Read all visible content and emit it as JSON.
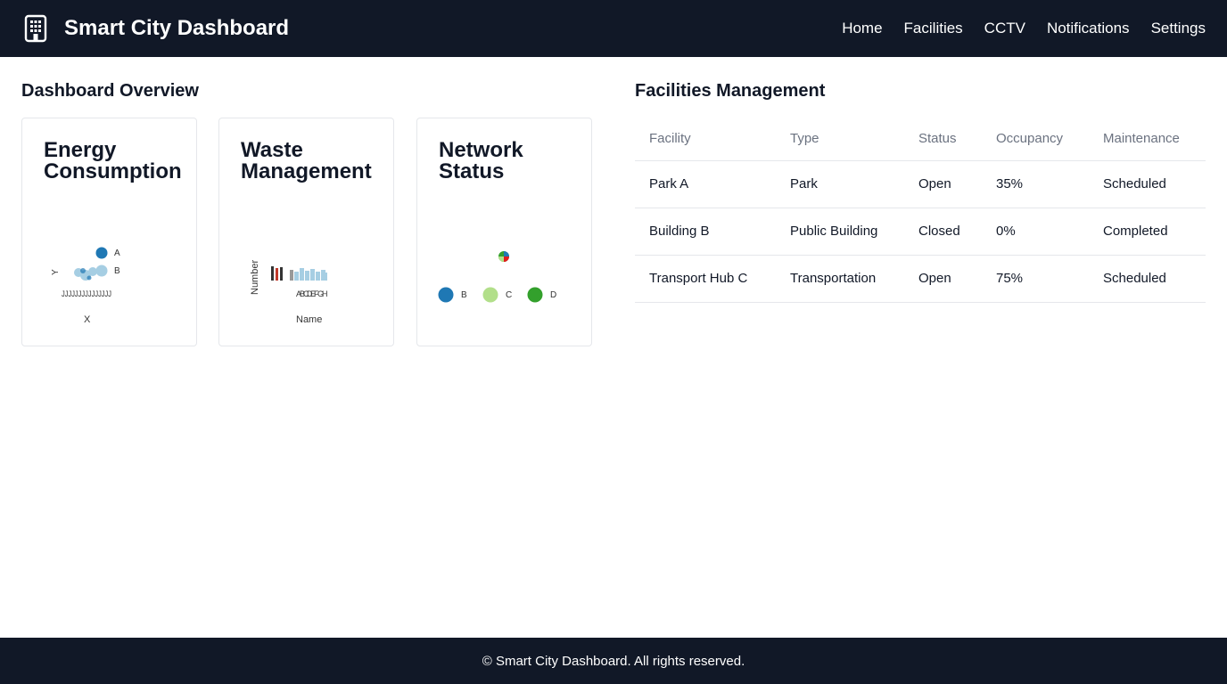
{
  "app": {
    "title": "Smart City Dashboard",
    "logo_icon": "building-icon"
  },
  "nav": {
    "items": [
      "Home",
      "Facilities",
      "CCTV",
      "Notifications",
      "Settings"
    ]
  },
  "overview": {
    "title": "Dashboard Overview",
    "cards": [
      {
        "title": "Energy Consumption"
      },
      {
        "title": "Waste Management"
      },
      {
        "title": "Network Status"
      }
    ]
  },
  "facilities": {
    "title": "Facilities Management",
    "columns": [
      "Facility",
      "Type",
      "Status",
      "Occupancy",
      "Maintenance"
    ],
    "rows": [
      [
        "Park A",
        "Park",
        "Open",
        "35%",
        "Scheduled"
      ],
      [
        "Building B",
        "Public Building",
        "Closed",
        "0%",
        "Completed"
      ],
      [
        "Transport Hub C",
        "Transportation",
        "Open",
        "75%",
        "Scheduled"
      ]
    ]
  },
  "footer": {
    "text": "© Smart City Dashboard. All rights reserved."
  },
  "colors": {
    "header_bg": "#111827",
    "series_dark_blue": "#1f78b4",
    "series_light_blue": "#a6cee3",
    "series_light_green": "#b2df8a",
    "series_green": "#33a02c"
  },
  "chart_data": [
    {
      "type": "scatter",
      "xlabel": "X",
      "ylabel": "Y",
      "series": [
        {
          "name": "A",
          "color": "#1f78b4"
        },
        {
          "name": "B",
          "color": "#a6cee3"
        }
      ]
    },
    {
      "type": "bar",
      "xlabel": "Name",
      "ylabel": "Number",
      "categories": [
        "A",
        "B",
        "C",
        "D",
        "E",
        "F",
        "G",
        "H"
      ]
    },
    {
      "type": "pie",
      "legend": [
        "B",
        "C",
        "D"
      ],
      "colors": [
        "#1f78b4",
        "#b2df8a",
        "#33a02c"
      ]
    }
  ]
}
